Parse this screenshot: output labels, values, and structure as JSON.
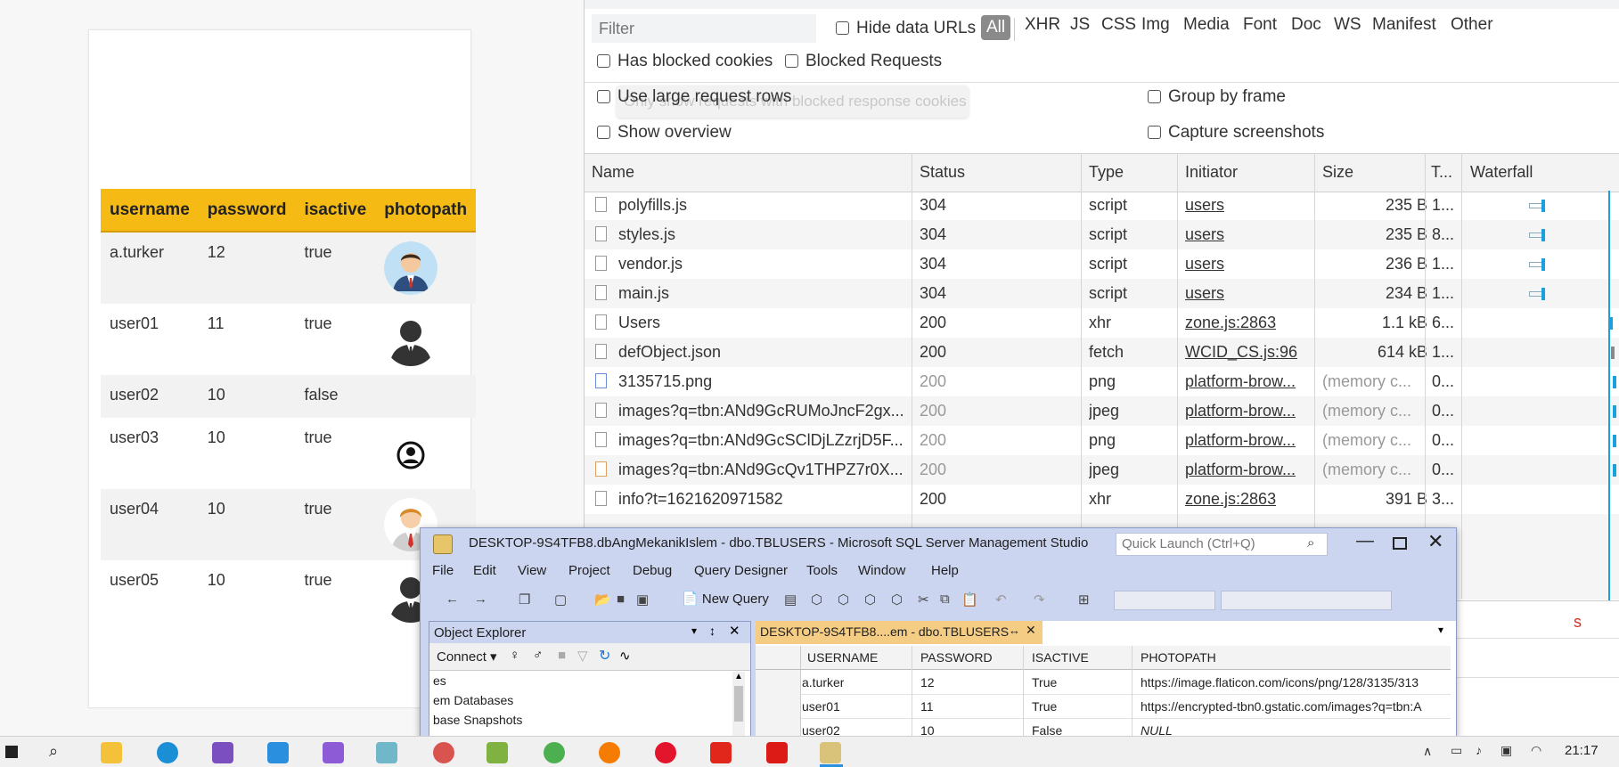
{
  "webpage": {
    "table": {
      "headers": [
        "username",
        "password",
        "isactive",
        "photopath"
      ],
      "rows": [
        {
          "username": "a.turker",
          "password": "12",
          "isactive": "true",
          "photo_icon": "businessman-avatar-icon"
        },
        {
          "username": "user01",
          "password": "11",
          "isactive": "true",
          "photo_icon": "silhouette-man-icon"
        },
        {
          "username": "user02",
          "password": "10",
          "isactive": "false",
          "photo_icon": ""
        },
        {
          "username": "user03",
          "password": "10",
          "isactive": "true",
          "photo_icon": "person-circle-icon"
        },
        {
          "username": "user04",
          "password": "10",
          "isactive": "true",
          "photo_icon": "man-tie-avatar-icon"
        },
        {
          "username": "user05",
          "password": "10",
          "isactive": "true",
          "photo_icon": "silhouette-man-icon"
        }
      ]
    },
    "colors": {
      "header_bg": "#f5bb14"
    }
  },
  "devtools": {
    "filter_placeholder": "Filter",
    "hide_data_urls": "Hide data URLs",
    "type_filters": [
      "All",
      "XHR",
      "JS",
      "CSS",
      "Img",
      "Media",
      "Font",
      "Doc",
      "WS",
      "Manifest",
      "Other"
    ],
    "has_blocked_cookies": "Has blocked cookies",
    "blocked_requests": "Blocked Requests",
    "use_large_rows": "Use large request rows",
    "tooltip_text": "Only show requests with blocked response cookies",
    "group_by_frame": "Group by frame",
    "show_overview": "Show overview",
    "capture_screenshots": "Capture screenshots",
    "columns": [
      "Name",
      "Status",
      "Type",
      "Initiator",
      "Size",
      "T...",
      "Waterfall"
    ],
    "requests": [
      {
        "name": "polyfills.js",
        "status": "304",
        "type": "script",
        "initiator": "users",
        "size": "235 B",
        "time": "1..."
      },
      {
        "name": "styles.js",
        "status": "304",
        "type": "script",
        "initiator": "users",
        "size": "235 B",
        "time": "8..."
      },
      {
        "name": "vendor.js",
        "status": "304",
        "type": "script",
        "initiator": "users",
        "size": "236 B",
        "time": "1..."
      },
      {
        "name": "main.js",
        "status": "304",
        "type": "script",
        "initiator": "users",
        "size": "234 B",
        "time": "1..."
      },
      {
        "name": "Users",
        "status": "200",
        "type": "xhr",
        "initiator": "zone.js:2863",
        "size": "1.1 kB",
        "time": "6..."
      },
      {
        "name": "defObject.json",
        "status": "200",
        "type": "fetch",
        "initiator": "WCID_CS.js:96",
        "size": "614 kB",
        "time": "1..."
      },
      {
        "name": "3135715.png",
        "status": "200",
        "type": "png",
        "initiator": "platform-brow...",
        "size": "(memory c...",
        "time": "0..."
      },
      {
        "name": "images?q=tbn:ANd9GcRUMoJncF2gx...",
        "status": "200",
        "type": "jpeg",
        "initiator": "platform-brow...",
        "size": "(memory c...",
        "time": "0..."
      },
      {
        "name": "images?q=tbn:ANd9GcSClDjLZzrjD5F...",
        "status": "200",
        "type": "png",
        "initiator": "platform-brow...",
        "size": "(memory c...",
        "time": "0..."
      },
      {
        "name": "images?q=tbn:ANd9GcQv1THPZ7r0X...",
        "status": "200",
        "type": "jpeg",
        "initiator": "platform-brow...",
        "size": "(memory c...",
        "time": "0..."
      },
      {
        "name": "info?t=1621620971582",
        "status": "200",
        "type": "xhr",
        "initiator": "zone.js:2863",
        "size": "391 B",
        "time": "3..."
      }
    ],
    "partial_red_text": "s"
  },
  "ssms": {
    "title": "DESKTOP-9S4TFB8.dbAngMekanikIslem - dbo.TBLUSERS - Microsoft SQL Server Management Studio",
    "quick_launch_placeholder": "Quick Launch (Ctrl+Q)",
    "menu": [
      "File",
      "Edit",
      "View",
      "Project",
      "Debug",
      "Query Designer",
      "Tools",
      "Window",
      "Help"
    ],
    "new_query_label": "New Query",
    "object_explorer": {
      "title": "Object Explorer",
      "connect_label": "Connect",
      "tree": [
        "es",
        "em Databases",
        "base Snapshots"
      ]
    },
    "doc_tab": "DESKTOP-9S4TFB8....em - dbo.TBLUSERS",
    "grid": {
      "columns": [
        "USERNAME",
        "PASSWORD",
        "ISACTIVE",
        "PHOTOPATH"
      ],
      "rows": [
        [
          "a.turker",
          "12",
          "True",
          "https://image.flaticon.com/icons/png/128/3135/313"
        ],
        [
          "user01",
          "11",
          "True",
          "https://encrypted-tbn0.gstatic.com/images?q=tbn:A"
        ],
        [
          "user02",
          "10",
          "False",
          "NULL"
        ]
      ]
    }
  },
  "taskbar": {
    "clock": "21:17",
    "apps": [
      "windows-start-icon",
      "search-icon",
      "file-explorer-icon",
      "edge-icon",
      "visual-studio-icon",
      "vscode-icon",
      "visual-studio-2-icon",
      "app-icon",
      "app-icon-2",
      "app-icon-3",
      "chrome-icon",
      "firefox-icon",
      "opera-icon",
      "adobe-icon",
      "angular-icon",
      "ssms-icon"
    ]
  }
}
